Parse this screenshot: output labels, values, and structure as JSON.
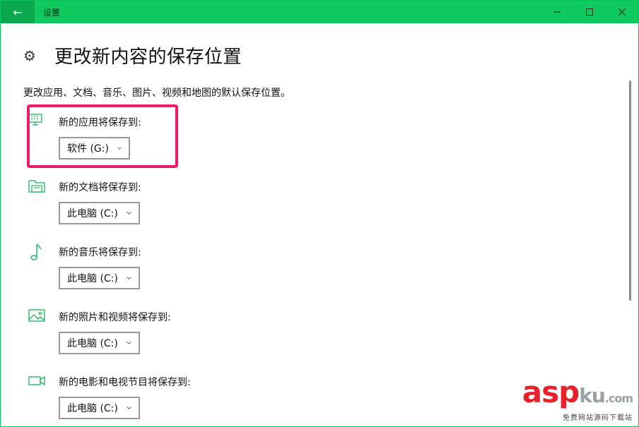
{
  "window": {
    "title": "设置",
    "back_icon": "arrow-left-icon",
    "minimize_icon": "minimize-icon",
    "maximize_icon": "maximize-icon",
    "close_icon": "close-icon",
    "accent": "#0fcb5f"
  },
  "page": {
    "title": "更改新内容的保存位置",
    "description": "更改应用、文档、音乐、图片、视频和地图的默认保存位置。"
  },
  "settings": [
    {
      "icon": "monitor-keyboard-icon",
      "label": "新的应用将保存到:",
      "value": "软件 (G:)"
    },
    {
      "icon": "folder-icon",
      "label": "新的文档将保存到:",
      "value": "此电脑 (C:)"
    },
    {
      "icon": "music-note-icon",
      "label": "新的音乐将保存到:",
      "value": "此电脑 (C:)"
    },
    {
      "icon": "picture-icon",
      "label": "新的照片和视频将保存到:",
      "value": "此电脑 (C:)"
    },
    {
      "icon": "video-camera-icon",
      "label": "新的电影和电视节目将保存到:",
      "value": "此电脑 (C:)"
    }
  ],
  "watermark": {
    "brand_a": "asp",
    "brand_b": "ku",
    "brand_c": ".com",
    "sub": "免费网站源码下载站"
  },
  "colors": {
    "highlight": "#f0196b",
    "icon_green": "#14b25a"
  }
}
